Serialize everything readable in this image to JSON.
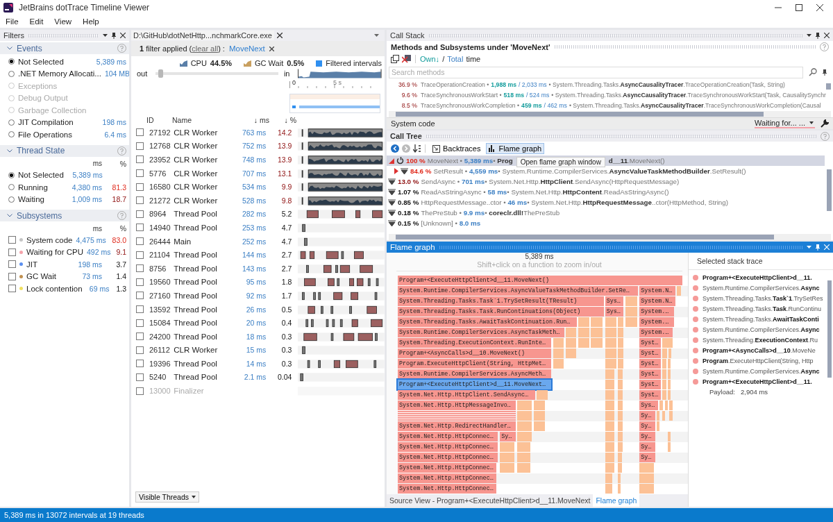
{
  "window": {
    "title": "JetBrains dotTrace Timeline Viewer"
  },
  "menu": [
    "File",
    "Edit",
    "View",
    "Help"
  ],
  "filters": {
    "title": "Filters",
    "events": {
      "title": "Events",
      "items": [
        {
          "label": "Not Selected",
          "value": "5,389 ms",
          "selected": true,
          "disabled": false
        },
        {
          "label": ".NET Memory Allocati...",
          "value": "104 MB",
          "selected": false,
          "disabled": false
        },
        {
          "label": "Exceptions",
          "selected": false,
          "disabled": true
        },
        {
          "label": "Debug Output",
          "selected": false,
          "disabled": true
        },
        {
          "label": "Garbage Collection",
          "selected": false,
          "disabled": true
        },
        {
          "label": "JIT Compilation",
          "value": "198 ms",
          "selected": false,
          "disabled": false
        },
        {
          "label": "File Operations",
          "value": "6.4 ms",
          "selected": false,
          "disabled": false
        }
      ]
    },
    "thread_state": {
      "title": "Thread State",
      "col_ms": "ms",
      "col_pct": "%",
      "items": [
        {
          "label": "Not Selected",
          "ms": "5,389 ms",
          "selected": true,
          "critical": false,
          "warning": false
        },
        {
          "label": "Running",
          "ms": "4,380 ms",
          "pct": "81.3",
          "critical": true,
          "warning": false,
          "selected": false
        },
        {
          "label": "Waiting",
          "ms": "1,009 ms",
          "pct": "18.7",
          "critical": false,
          "warning": true,
          "selected": false
        }
      ]
    },
    "subsystems": {
      "title": "Subsystems",
      "col_ms": "ms",
      "col_pct": "%",
      "items": [
        {
          "label": "System code",
          "color": "#c4c4c4",
          "ms": "4,475 ms",
          "pct": "83.0",
          "critical": true,
          "warning": false,
          "checked": false
        },
        {
          "label": "Waiting for CPU",
          "color": "#f5a3ab",
          "ms": "492 ms",
          "pct": "9.1",
          "critical": false,
          "warning": true,
          "checked": false
        },
        {
          "label": "JIT",
          "color": "#5b8ff0",
          "ms": "198 ms",
          "pct": "3.7",
          "critical": false,
          "warning": false,
          "checked": false
        },
        {
          "label": "GC Wait",
          "color": "#c09050",
          "ms": "73 ms",
          "pct": "1.4",
          "critical": false,
          "warning": false,
          "checked": false
        },
        {
          "label": "Lock contention",
          "color": "#f0e060",
          "ms": "69 ms",
          "pct": "1.3",
          "critical": false,
          "warning": false,
          "checked": false
        }
      ]
    }
  },
  "threads_panel": {
    "tab": "D:\\GitHub\\dotNetHttp...nchmarkCore.exe",
    "filter_prefix": "**1** filter applied (",
    "clear_all": "clear all",
    "filter_suffix": ") :",
    "filter_name": "MoveNext",
    "legend": [
      {
        "label": "CPU",
        "value": "44.5%",
        "kind": "cpu"
      },
      {
        "label": "GC Wait",
        "value": "0.5%",
        "kind": "gc"
      },
      {
        "label": "Filtered intervals",
        "kind": "filtered"
      }
    ],
    "zoom": {
      "out": "out",
      "in": "in",
      "level": 0.02
    },
    "ruler": [
      "0",
      "5 s"
    ],
    "columns": {
      "id": "ID",
      "name": "Name",
      "ms": "↓ ms",
      "pct": "↓ %"
    },
    "threads": [
      {
        "id": "27192",
        "name": "CLR Worker",
        "ms": "763 ms",
        "pct": "14.2",
        "warning": true,
        "kind": "dense",
        "checked": false,
        "disabled": false
      },
      {
        "id": "12768",
        "name": "CLR Worker",
        "ms": "752 ms",
        "pct": "13.9",
        "warning": true,
        "kind": "dense",
        "checked": false,
        "disabled": false
      },
      {
        "id": "23952",
        "name": "CLR Worker",
        "ms": "748 ms",
        "pct": "13.9",
        "warning": true,
        "kind": "dense",
        "checked": false,
        "disabled": false
      },
      {
        "id": "5776",
        "name": "CLR Worker",
        "ms": "707 ms",
        "pct": "13.1",
        "warning": true,
        "kind": "dense",
        "checked": false,
        "disabled": false
      },
      {
        "id": "16580",
        "name": "CLR Worker",
        "ms": "534 ms",
        "pct": "9.9",
        "warning": true,
        "kind": "dense",
        "checked": false,
        "disabled": false
      },
      {
        "id": "21272",
        "name": "CLR Worker",
        "ms": "528 ms",
        "pct": "9.8",
        "warning": true,
        "kind": "dense",
        "checked": false,
        "disabled": false
      },
      {
        "id": "8964",
        "name": "Thread Pool",
        "ms": "282 ms",
        "pct": "5.2",
        "warning": false,
        "kind": "sparse",
        "checked": false,
        "disabled": false
      },
      {
        "id": "14940",
        "name": "Thread Pool",
        "ms": "253 ms",
        "pct": "4.7",
        "warning": false,
        "kind": "tick",
        "checked": false,
        "disabled": false
      },
      {
        "id": "26444",
        "name": "Main",
        "ms": "252 ms",
        "pct": "4.7",
        "warning": false,
        "kind": "tick",
        "checked": false,
        "disabled": false
      },
      {
        "id": "21104",
        "name": "Thread Pool",
        "ms": "144 ms",
        "pct": "2.7",
        "warning": false,
        "kind": "sparse",
        "checked": false,
        "disabled": false
      },
      {
        "id": "8756",
        "name": "Thread Pool",
        "ms": "143 ms",
        "pct": "2.7",
        "warning": false,
        "kind": "sparse",
        "checked": false,
        "disabled": false
      },
      {
        "id": "19560",
        "name": "Thread Pool",
        "ms": "95 ms",
        "pct": "1.8",
        "warning": false,
        "kind": "sparse",
        "checked": false,
        "disabled": false
      },
      {
        "id": "27160",
        "name": "Thread Pool",
        "ms": "92 ms",
        "pct": "1.7",
        "warning": false,
        "kind": "sparse",
        "checked": false,
        "disabled": false
      },
      {
        "id": "13592",
        "name": "Thread Pool",
        "ms": "26 ms",
        "pct": "0.5",
        "warning": false,
        "kind": "sparse",
        "checked": false,
        "disabled": false
      },
      {
        "id": "15084",
        "name": "Thread Pool",
        "ms": "20 ms",
        "pct": "0.4",
        "warning": false,
        "kind": "sparse",
        "checked": false,
        "disabled": false
      },
      {
        "id": "24200",
        "name": "Thread Pool",
        "ms": "18 ms",
        "pct": "0.3",
        "warning": false,
        "kind": "sparse",
        "checked": false,
        "disabled": false
      },
      {
        "id": "26112",
        "name": "CLR Worker",
        "ms": "15 ms",
        "pct": "0.3",
        "warning": false,
        "kind": "tick",
        "checked": false,
        "disabled": false
      },
      {
        "id": "19396",
        "name": "Thread Pool",
        "ms": "14 ms",
        "pct": "0.3",
        "warning": false,
        "kind": "sparse",
        "checked": false,
        "disabled": false
      },
      {
        "id": "5240",
        "name": "Thread Pool",
        "ms": "2.1 ms",
        "pct": "0.04",
        "warning": false,
        "kind": "tick",
        "checked": false,
        "disabled": false
      },
      {
        "id": "13000",
        "name": "Finalizer",
        "warning": false,
        "kind": "empty",
        "checked": false,
        "disabled": true
      }
    ],
    "visible_threads": "Visible Threads"
  },
  "call_stack": {
    "title": "Call Stack",
    "subtitle": "Methods and Subsystems under 'MoveNext'",
    "own": "Own↓",
    "sep": "/",
    "total": "Total",
    "time": "time",
    "search_placeholder": "Search methods",
    "rows": [
      {
        "pct": "36.9 %",
        "name": "TraceOperationCreation •",
        "own": "1,988 ms",
        "total": "/ 2,033 ms",
        "method": "• System.Threading.Tasks.**AsyncCausalityTracer**.TraceOperationCreation(Task, String)"
      },
      {
        "pct": "9.6 %",
        "name": "TraceSynchronousWorkStart •",
        "own": "518 ms",
        "total": "/ 524 ms",
        "method": "• System.Threading.Tasks.**AsyncCausalityTracer**.TraceSynchronousWorkStart(Task, CausalitySynchr"
      },
      {
        "pct": "8.5 %",
        "name": "TraceSynchronousWorkCompletion •",
        "own": "459 ms",
        "total": "/ 462 ms",
        "method": "• System.Threading.Tasks.**AsyncCausalityTracer**.TraceSynchronousWorkCompletion(Causal"
      }
    ],
    "footer": "System code",
    "dropdown_label": "Waiting for...",
    "dropdown_more": "..."
  },
  "call_tree": {
    "title": "Call Tree",
    "backtraces": "Backtraces",
    "flame_graph": "Flame graph",
    "flame_selected": true,
    "tooltip": "Open flame graph window",
    "rows": [
      {
        "kind": "open",
        "selected": true,
        "pct": "100 %",
        "critical": true,
        "warning": false,
        "name": "MoveNext •",
        "ms": "5,389 ms",
        "method": "• **Prog**",
        "method_end": "**d__11**.MoveNext()"
      },
      {
        "kind": "closed",
        "selected": false,
        "pct": "84.6 %",
        "critical": true,
        "warning": false,
        "name": "SetResult •",
        "ms": "4,559 ms",
        "method": "• System.Runtime.CompilerServices.**AsyncValueTaskMethodBuilder**.SetResult()"
      },
      {
        "kind": "leaf",
        "selected": false,
        "pct": "13.0 %",
        "critical": false,
        "warning": true,
        "name": "SendAsync •",
        "ms": "701 ms",
        "method": "• System.Net.Http.**HttpClient**.SendAsync(HttpRequestMessage)"
      },
      {
        "kind": "leaf",
        "selected": false,
        "pct": "1.07 %",
        "critical": false,
        "warning": false,
        "name": "ReadAsStringAsync •",
        "ms": "58 ms",
        "method": "• System.Net.Http.**HttpContent**.ReadAsStringAsync()"
      },
      {
        "kind": "leaf",
        "selected": false,
        "pct": "0.85 %",
        "critical": false,
        "warning": false,
        "name": "HttpRequestMessage..ctor •",
        "ms": "46 ms",
        "method": "• System.Net.Http.**HttpRequestMessage**..ctor(HttpMethod, String)"
      },
      {
        "kind": "leaf",
        "selected": false,
        "pct": "0.18 %",
        "critical": false,
        "warning": false,
        "name": "ThePreStub •",
        "ms": "9.9 ms",
        "method": "• **coreclr.dll!**ThePreStub"
      },
      {
        "kind": "leaf",
        "selected": false,
        "pct": "0.15 %",
        "critical": false,
        "warning": false,
        "name": "[Unknown] •",
        "ms": "8.0 ms"
      }
    ]
  },
  "flame_graph": {
    "title": "Flame graph",
    "total": "5,389 ms",
    "hint": "Shift+click on a function to zoom in/out",
    "rows": [
      {
        "blocks": [
          {
            "label": "Program+<ExecuteHttpClient>d__11.MoveNext()",
            "selected": false
          }
        ]
      },
      {
        "blocks": [
          {
            "label": "System.Runtime.CompilerServices.AsyncValueTaskMethodBuilder.SetRe…",
            "selected": false
          },
          {
            "label": "System.N…",
            "selected": false
          }
        ]
      },
      {
        "blocks": [
          {
            "label": "System.Threading.Tasks.Task`1.TrySetResult(TResult)",
            "selected": false
          },
          {
            "label": "Sys…",
            "selected": false
          },
          {
            "label": "System.N…",
            "selected": false
          }
        ]
      },
      {
        "blocks": [
          {
            "label": "System.Threading.Tasks.Task.RunContinuations(Object)",
            "selected": false
          },
          {
            "label": "Sys…",
            "selected": false
          },
          {
            "label": "System.…",
            "selected": false
          }
        ]
      },
      {
        "blocks": [
          {
            "label": "System.Threading.Tasks.AwaitTaskContinuation.Run…",
            "selected": false
          },
          {
            "label": "System.…",
            "selected": false
          }
        ]
      },
      {
        "blocks": [
          {
            "label": "System.Runtime.CompilerServices.AsyncTaskMeth…",
            "selected": false
          },
          {
            "label": "System.…",
            "selected": false
          }
        ]
      },
      {
        "blocks": [
          {
            "label": "System.Threading.ExecutionContext.RunInte…",
            "selected": false
          },
          {
            "label": "Syst…",
            "selected": false
          }
        ]
      },
      {
        "blocks": [
          {
            "label": "Program+<AsyncCalls>d__10.MoveNext()",
            "selected": false
          },
          {
            "label": "Syst…",
            "selected": false
          }
        ]
      },
      {
        "blocks": [
          {
            "label": "Program.ExecuteHttpClient(String, HttpMet…",
            "selected": false
          },
          {
            "label": "Syst…",
            "selected": false
          }
        ]
      },
      {
        "blocks": [
          {
            "label": "System.Runtime.CompilerServices.AsyncMeth…",
            "selected": false
          },
          {
            "label": "Syst…",
            "selected": false
          }
        ]
      },
      {
        "blocks": [
          {
            "label": "Program+<ExecuteHttpClient>d__11.MoveNext…",
            "selected": true
          },
          {
            "label": "Syst…",
            "selected": false
          }
        ]
      },
      {
        "blocks": [
          {
            "label": "System.Net.Http.HttpClient.SendAsync…",
            "selected": false
          },
          {
            "label": "Syst…",
            "selected": false
          }
        ]
      },
      {
        "blocks": [
          {
            "label": "System.Net.Http.HttpMessageInvo…",
            "selected": false
          },
          {
            "label": "Sys…",
            "selected": false
          }
        ]
      },
      {
        "blocks": [
          {
            "label": "Sy…",
            "selected": false
          }
        ]
      },
      {
        "blocks": [
          {
            "label": "System.Net.Http.RedirectHandler…",
            "selected": false
          },
          {
            "label": "Sy…",
            "selected": false
          }
        ]
      },
      {
        "blocks": [
          {
            "label": "System.Net.Http.HttpConnec…",
            "selected": false
          },
          {
            "label": "Sy…",
            "selected": false
          },
          {
            "label": "Sy…",
            "selected": false
          }
        ]
      },
      {
        "blocks": [
          {
            "label": "System.Net.Http.HttpConnec…",
            "selected": false
          },
          {
            "label": "Sy…",
            "selected": false
          }
        ]
      },
      {
        "blocks": [
          {
            "label": "System.Net.Http.HttpConnec…",
            "selected": false
          },
          {
            "label": "Sy…",
            "selected": false
          }
        ]
      },
      {
        "blocks": [
          {
            "label": "System.Net.Http.HttpConnec…",
            "selected": false
          }
        ]
      },
      {
        "blocks": [
          {
            "label": "System.Net.Http.HttpConnec…",
            "selected": false
          }
        ]
      },
      {
        "blocks": [
          {
            "label": "System.Net.Http.HttpConnec…",
            "selected": false
          }
        ]
      }
    ],
    "trace_title": "Selected stack trace",
    "trace": [
      {
        "text": "Program+<ExecuteHttpClient>d__11.",
        "bold": true
      },
      {
        "text": "System.Runtime.CompilerServices.**Async**",
        "bold": false
      },
      {
        "text": "System.Threading.Tasks.**Task`1**.TrySetRes",
        "bold": false
      },
      {
        "text": "System.Threading.Tasks.**Task**.RunContinu",
        "bold": false
      },
      {
        "text": "System.Threading.Tasks.**AwaitTaskConti**",
        "bold": false
      },
      {
        "text": "System.Runtime.CompilerServices.**Async**",
        "bold": false
      },
      {
        "text": "System.Threading.**ExecutionContext**.Ru",
        "bold": false
      },
      {
        "text": "**Program+<AsyncCalls>d__10**.MoveNe",
        "bold": false
      },
      {
        "text": "**Program**.ExecuteHttpClient(String, Http",
        "bold": false
      },
      {
        "text": "System.Runtime.CompilerServices.**Async**",
        "bold": false
      },
      {
        "text": "Program+<ExecuteHttpClient>d__11.",
        "bold": true
      }
    ],
    "payload_label": "Payload:",
    "payload_value": "2,904 ms",
    "tabs": [
      {
        "label": "Source View - Program+<ExecuteHttpClient>d__11.MoveNext",
        "selected": false
      },
      {
        "label": "Flame graph",
        "selected": true
      }
    ]
  },
  "status_bar": "5,389 ms in 13072 intervals at 19 threads"
}
